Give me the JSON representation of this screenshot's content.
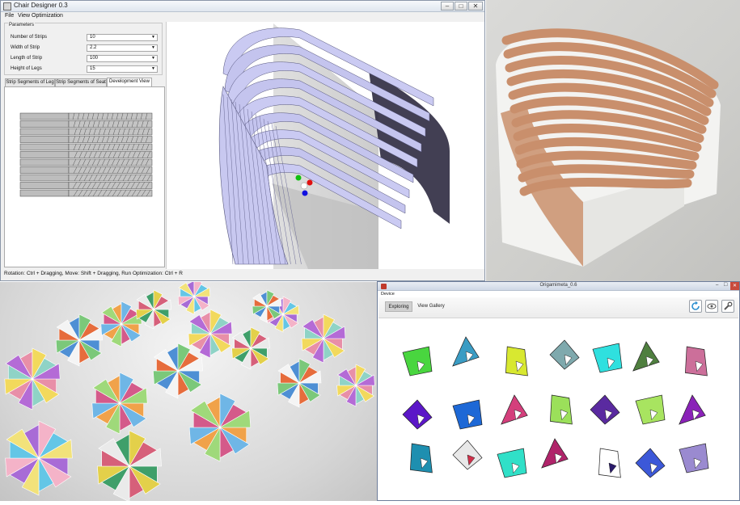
{
  "chair_designer": {
    "title": "Chair Designer 0.3",
    "menu": [
      "File",
      "View",
      "Optimization"
    ],
    "params_legend": "Parameters",
    "params": [
      {
        "label": "Number of Strips",
        "value": "10"
      },
      {
        "label": "Width of Strip",
        "value": "2.2"
      },
      {
        "label": "Length of Strip",
        "value": "100"
      },
      {
        "label": "Height of Legs",
        "value": "15"
      }
    ],
    "tabs": [
      "Strip Segments of Leg",
      "Strip Segments of Seat",
      "Development View"
    ],
    "active_tab": "Development View",
    "strip_count": 11,
    "status": "Rotation: Ctrl + Dragging, Move: Shift + Dragging, Run Optimization: Ctrl + R"
  },
  "origamimeta": {
    "title": "Origamimeta_0.6",
    "menu": "Device",
    "tabs": [
      "Exploring",
      "View Gallery"
    ],
    "active_tab": "Exploring",
    "toolbar_icons": [
      "refresh-icon",
      "eye-icon",
      "wrench-icon"
    ]
  },
  "colors": {
    "strip_fill": "#c8c8f0",
    "strip_dark": "#3a3550",
    "axis_x": "#e01010",
    "axis_y": "#10c010",
    "axis_z": "#1010e0",
    "chair_leather": "#c98f6c"
  }
}
